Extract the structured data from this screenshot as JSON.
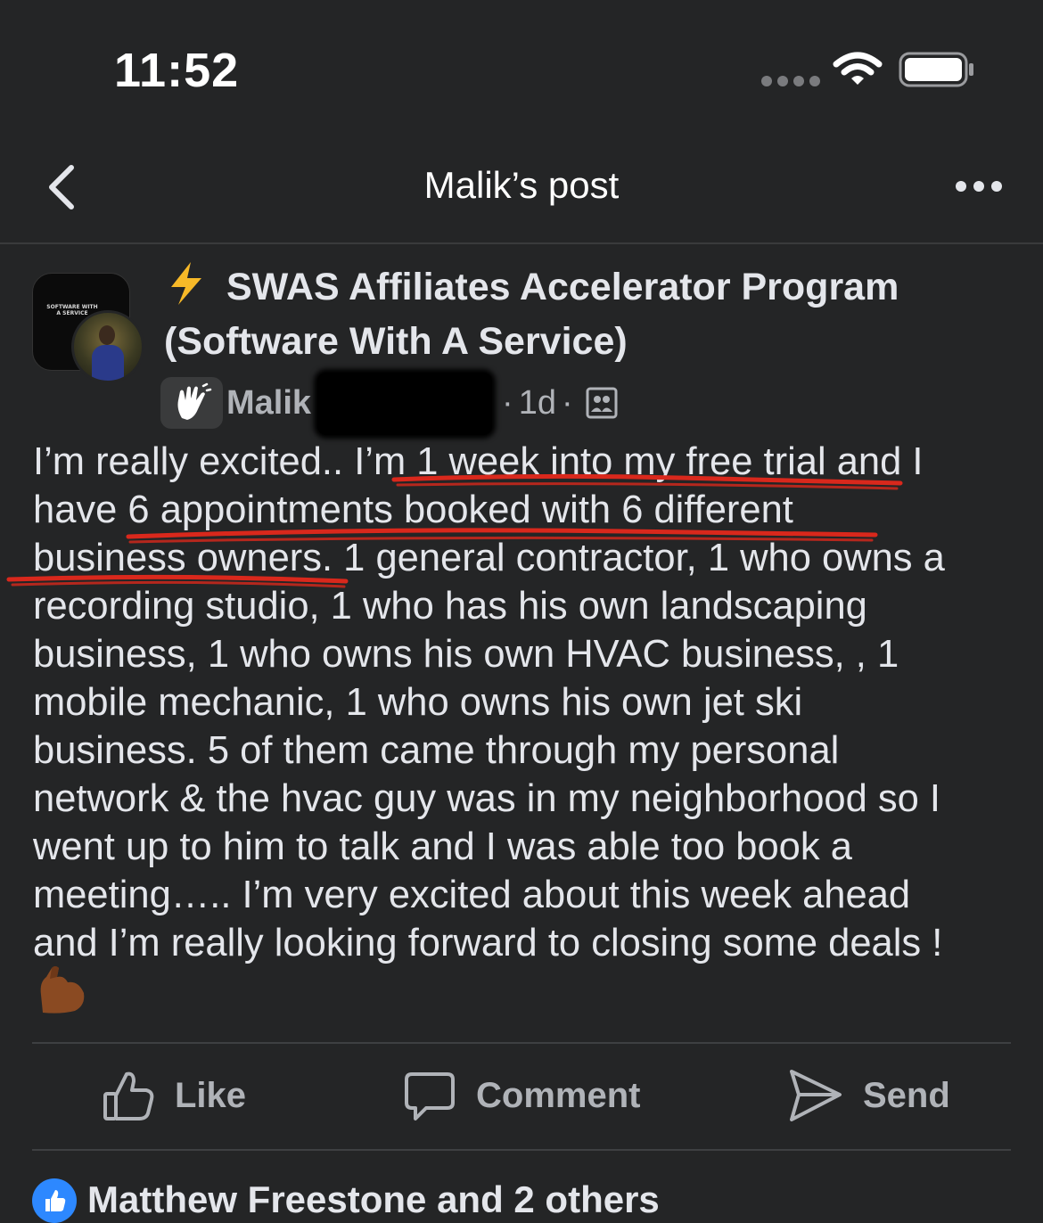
{
  "status_bar": {
    "time": "11:52"
  },
  "nav": {
    "title": "Malik’s post",
    "back_icon": "chevron-left-icon",
    "more_icon": "more-horizontal-icon"
  },
  "post": {
    "group_name": "SWAS Affiliates Accelerator Program (Software With A Service)",
    "group_avatar_text": "SOFTWARE WITH A SERVICE",
    "author_first_name": "Malik",
    "time": "1d",
    "separator": "·",
    "body": "I’m really excited.. I’m 1 week into my free trial and I\nhave 6 appointments booked with 6 different\nbusiness owners. 1 general contractor, 1 who owns a\nrecording studio, 1 who has his own landscaping\nbusiness, 1 who owns his own HVAC business, , 1\nmobile mechanic, 1 who owns his own jet ski\nbusiness. 5 of them came through my personal\nnetwork & the hvac guy was in my neighborhood so I\nwent up to him to talk and I was able too book a\nmeeting….. I’m very excited about this week ahead\nand I’m really looking forward to closing some deals !",
    "emoji": "flexed-biceps-emoji"
  },
  "actions": {
    "like": "Like",
    "comment": "Comment",
    "send": "Send"
  },
  "reactions": {
    "summary": "Matthew Freestone and 2 others"
  },
  "colors": {
    "background": "#242526",
    "text_primary": "#e4e6eb",
    "text_secondary": "#b0b3b8",
    "annotation_red": "#d9281c",
    "like_blue": "#2d88ff",
    "bolt_yellow": "#f7b928"
  }
}
